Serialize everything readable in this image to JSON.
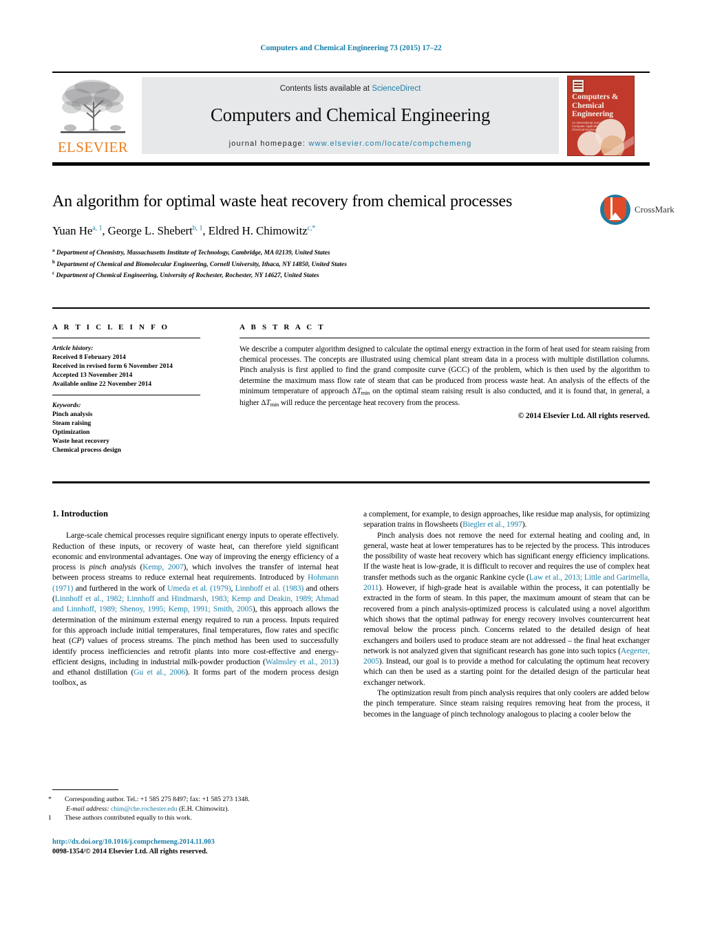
{
  "running_head": "Computers and Chemical Engineering 73 (2015) 17–22",
  "header": {
    "contents_prefix": "Contents lists available at ",
    "sciencedirect": "ScienceDirect",
    "journal_title": "Computers and Chemical Engineering",
    "homepage_label": "journal homepage: ",
    "homepage_url": "www.elsevier.com/locate/compchemeng",
    "publisher_logo_text": "ELSEVIER",
    "cover_title": "Computers & Chemical Engineering",
    "cover_subtitle": "An International Journal of Computer Applications in Chemical Engineering",
    "grey_bg": "#e7e8ea",
    "link_color": "#1b7fa8",
    "elsevier_orange": "#ef7d1a",
    "cover_red": "#c0392b"
  },
  "article": {
    "title": "An algorithm for optimal waste heat recovery from chemical processes",
    "authors_html": "Yuan He<sup>a, 1</sup>, George L. Shebert<sup>b, 1</sup>, Eldred H. Chimowitz<sup>c,</sup><sup class=\"star\">*</sup>",
    "affiliations": [
      {
        "mark": "a",
        "text": "Department of Chemistry, Massachusetts Institute of Technology, Cambridge, MA 02139, United States"
      },
      {
        "mark": "b",
        "text": "Department of Chemical and Biomolecular Engineering, Cornell University, Ithaca, NY 14850, United States"
      },
      {
        "mark": "c",
        "text": "Department of Chemical Engineering, University of Rochester, Rochester, NY 14627, United States"
      }
    ],
    "crossmark_label": "CrossMark"
  },
  "article_info": {
    "heading": "A R T I C L E   I N F O",
    "history_label": "Article history:",
    "history": [
      "Received 8 February 2014",
      "Received in revised form 6 November 2014",
      "Accepted 13 November 2014",
      "Available online 22 November 2014"
    ],
    "keywords_label": "Keywords:",
    "keywords": [
      "Pinch analysis",
      "Steam raising",
      "Optimization",
      "Waste heat recovery",
      "Chemical process design"
    ]
  },
  "abstract": {
    "heading": "A B S T R A C T",
    "body_html": "We describe a computer algorithm designed to calculate the optimal energy extraction in the form of heat used for steam raising from chemical processes. The concepts are illustrated using chemical plant stream data in a process with multiple distillation columns. Pinch analysis is first applied to find the grand composite curve (GCC) of the problem, which is then used by the algorithm to determine the maximum mass flow rate of steam that can be produced from process waste heat. An analysis of the effects of the minimum temperature of approach &Delta;<span class=\"ital\">T</span><span class=\"sub\">min</span> on the optimal steam raising result is also conducted, and it is found that, in general, a higher &Delta;<span class=\"ital\">T</span><span class=\"sub\">min</span> will reduce the percentage heat recovery from the process.",
    "copyright": "© 2014 Elsevier Ltd. All rights reserved."
  },
  "body": {
    "section_heading": "1.  Introduction",
    "left_paragraphs_html": [
      "Large-scale chemical processes require significant energy inputs to operate effectively. Reduction of these inputs, or recovery of waste heat, can therefore yield significant economic and environmental advantages. One way of improving the energy efficiency of a process is <span class=\"ital\">pinch analysis</span> (<span class=\"link\">Kemp, 2007</span>), which involves the transfer of internal heat between process streams to reduce external heat requirements. Introduced by <span class=\"link\">Hohmann (1971)</span> and furthered in the work of <span class=\"link\">Umeda et al. (1979)</span>, <span class=\"link\">Linnhoff et al. (1983)</span> and others (<span class=\"link\">Linnhoff et al., 1982; Linnhoff and Hindmarsh, 1983; Kemp and Deakin, 1989; Ahmad and Linnhoff, 1989; Shenoy, 1995; Kemp, 1991; Smith, 2005</span>), this approach allows the determination of the minimum external energy required to run a process. Inputs required for this approach include initial temperatures, final temperatures, flow rates and specific heat (<span class=\"ital\">CP</span>) values of process streams. The pinch method has been used to successfully identify process inefficiencies and retrofit plants into more cost-effective and energy-efficient designs, including in industrial milk-powder production (<span class=\"link\">Walmsley et al., 2013</span>) and ethanol distillation (<span class=\"link\">Gu et al., 2006</span>). It forms part of the modern process design toolbox, as"
    ],
    "right_paragraphs_html": [
      "a complement, for example, to design approaches, like residue map analysis, for optimizing separation trains in flowsheets (<span class=\"link\">Biegler et al., 1997</span>).",
      "Pinch analysis does not remove the need for external heating and cooling and, in general, waste heat at lower temperatures has to be rejected by the process. This introduces the possibility of waste heat recovery which has significant energy efficiency implications. If the waste heat is low-grade, it is difficult to recover and requires the use of complex heat transfer methods such as the organic Rankine cycle (<span class=\"link\">Law et al., 2013; Little and Garimella, 2011</span>). However, if high-grade heat is available within the process, it can potentially be extracted in the form of steam. In this paper, the maximum amount of steam that can be recovered from a pinch analysis-optimized process is calculated using a novel algorithm which shows that the optimal pathway for energy recovery involves countercurrent heat removal below the process pinch. Concerns related to the detailed design of heat exchangers and boilers used to produce steam are not addressed – the final heat exchanger network is not analyzed given that significant research has gone into such topics (<span class=\"link\">Aegerter, 2005</span>). Instead, our goal is to provide a method for calculating the optimum heat recovery which can then be used as a starting point for the detailed design of the particular heat exchanger network.",
      "The optimization result from pinch analysis requires that only coolers are added below the pinch temperature. Since steam raising requires removing heat from the process, it becomes in the language of pinch technology analogous to placing a cooler below the"
    ]
  },
  "footnotes": {
    "corresponding_mark": "*",
    "corresponding_text": "Corresponding author. Tel.: +1 585 275 8497; fax: +1 585 273 1348.",
    "email_label": "E-mail address:",
    "email": "chim@che.rochester.edu",
    "email_owner": "(E.H. Chimowitz).",
    "equal_mark": "1",
    "equal_text": "These authors contributed equally to this work.",
    "doi": "http://dx.doi.org/10.1016/j.compchemeng.2014.11.003",
    "issn_line": "0098-1354/© 2014 Elsevier Ltd. All rights reserved."
  }
}
